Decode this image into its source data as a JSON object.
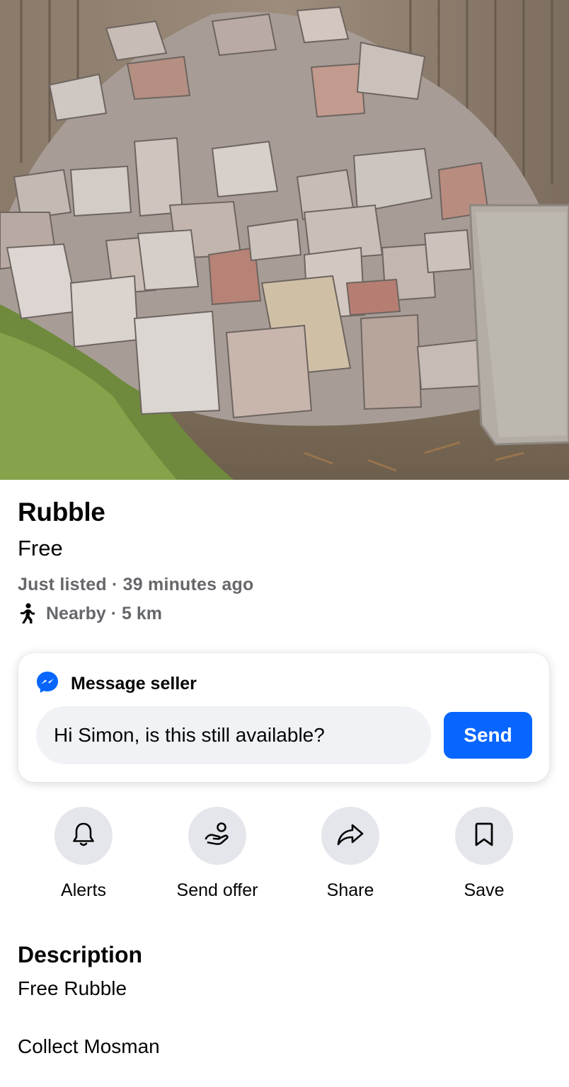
{
  "listing": {
    "title": "Rubble",
    "price": "Free",
    "listed": "Just listed · 39 minutes ago",
    "distance": "Nearby · 5 km"
  },
  "message": {
    "header": "Message seller",
    "input_value": "Hi Simon, is this still available?",
    "send_label": "Send"
  },
  "actions": [
    {
      "label": "Alerts",
      "icon": "bell-icon"
    },
    {
      "label": "Send offer",
      "icon": "offer-icon"
    },
    {
      "label": "Share",
      "icon": "share-icon"
    },
    {
      "label": "Save",
      "icon": "bookmark-icon"
    }
  ],
  "description": {
    "heading": "Description",
    "lines": [
      "Free Rubble",
      "Collect Mosman"
    ]
  },
  "colors": {
    "accent": "#0866ff",
    "secondary_text": "#65676b",
    "button_bg": "#e4e6eb",
    "input_bg": "#f0f2f5"
  }
}
